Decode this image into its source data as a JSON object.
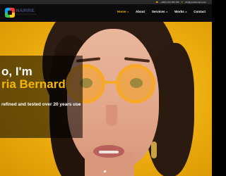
{
  "topbar": {
    "phone": "+33(0) 123 456 789",
    "email": "info@yourdomain.com"
  },
  "brand": {
    "name": "NAIRRIE",
    "tagline": "Professional Photography"
  },
  "nav": {
    "items": [
      {
        "label": "Home",
        "active": true,
        "has_caret": true
      },
      {
        "label": "About",
        "active": false,
        "has_caret": false
      },
      {
        "label": "Services",
        "active": false,
        "has_caret": true
      },
      {
        "label": "Works",
        "active": false,
        "has_caret": true
      },
      {
        "label": "Contact",
        "active": false,
        "has_caret": false
      }
    ]
  },
  "hero": {
    "line1": "o, I'm",
    "line2": "ria Bernard",
    "subtitle": "refined and tested over 20 years use"
  },
  "colors": {
    "accent": "#f5b800",
    "background": "#0b0b0b"
  }
}
